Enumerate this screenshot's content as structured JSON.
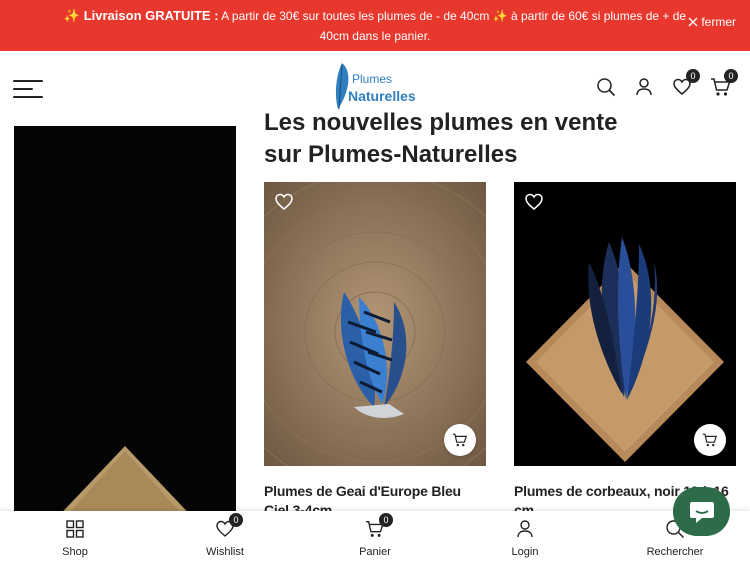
{
  "promo": {
    "bold": "✨ Livraison GRATUITE :",
    "text": "A partir de 30€ sur toutes les plumes de - de 40cm ✨ à partir de 60€ si plumes de + de 40cm dans le panier.",
    "close_label": "fermer"
  },
  "header": {
    "logo_line1": "Plumes",
    "logo_line2": "Naturelles",
    "wishlist_count": "0",
    "cart_count": "0"
  },
  "section": {
    "title": "Les nouvelles plumes en vente sur Plumes-Naturelles"
  },
  "products": [
    {
      "title": "Plumes de Geai d'Europe Bleu Ciel 3-4cm"
    },
    {
      "title": "Plumes de corbeaux, noir 12 à 16 cm"
    }
  ],
  "bottom_nav": {
    "shop": "Shop",
    "wishlist": "Wishlist",
    "wishlist_count": "0",
    "panier": "Panier",
    "panier_count": "0",
    "login": "Login",
    "search": "Rechercher"
  },
  "colors": {
    "promo_bg": "#e8372d",
    "chat_bg": "#2d6b49",
    "logo_blue": "#2f7fbf"
  }
}
